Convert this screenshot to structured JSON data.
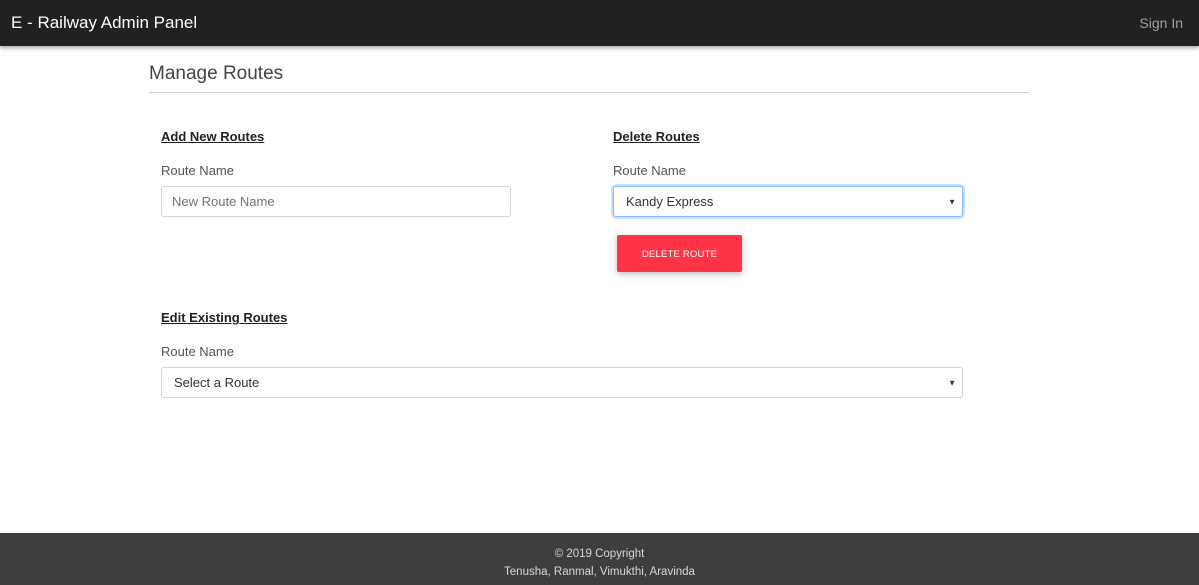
{
  "navbar": {
    "brand": "E - Railway Admin Panel",
    "sign_in": "Sign In"
  },
  "page": {
    "title": "Manage Routes"
  },
  "add_section": {
    "heading": "Add New Routes",
    "label": "Route Name",
    "placeholder": "New Route Name",
    "value": ""
  },
  "delete_section": {
    "heading": "Delete Routes",
    "label": "Route Name",
    "selected": "Kandy Express",
    "button_label": "DELETE ROUTE"
  },
  "edit_section": {
    "heading": "Edit Existing Routes",
    "label": "Route Name",
    "selected": "Select a Route"
  },
  "footer": {
    "copyright": "© 2019 Copyright",
    "authors": "Tenusha, Ranmal, Vimukthi, Aravinda"
  },
  "colors": {
    "navbar_bg": "#212121",
    "danger_button": "#ff3547",
    "footer_bg": "#3e3e3e",
    "focus_border": "#80bdff"
  },
  "icons": {
    "select_caret": "caret-down-icon"
  }
}
